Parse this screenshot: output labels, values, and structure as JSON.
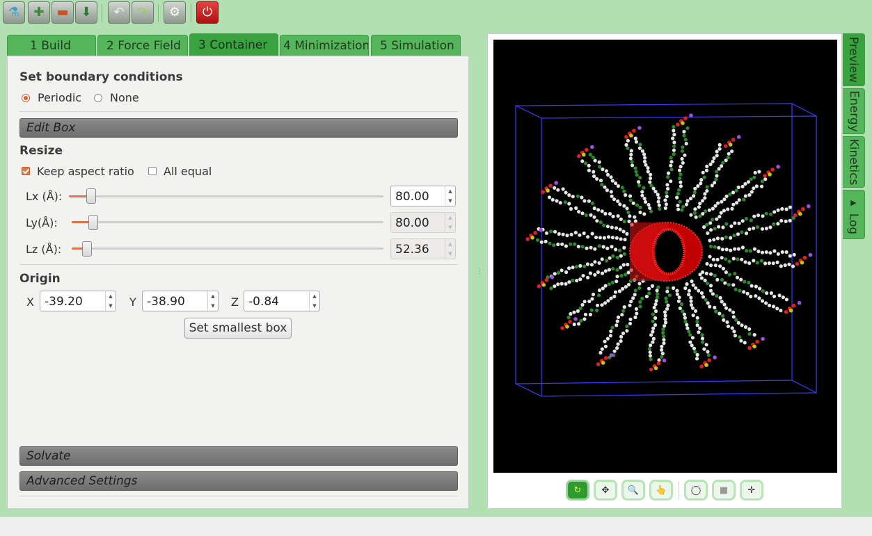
{
  "toolbar": {
    "buttons": [
      {
        "icon": "flask-icon",
        "glyph": "⚗"
      },
      {
        "icon": "new-document-icon",
        "glyph": "✚"
      },
      {
        "icon": "open-folder-icon",
        "glyph": "▬"
      },
      {
        "icon": "save-download-icon",
        "glyph": "⬇"
      },
      {
        "icon": "undo-icon",
        "glyph": "↶"
      },
      {
        "icon": "redo-icon",
        "glyph": "↷"
      },
      {
        "icon": "settings-gear-icon",
        "glyph": "⚙"
      },
      {
        "icon": "power-icon",
        "glyph": "⏻"
      }
    ]
  },
  "tabs": [
    {
      "label": "1  Build"
    },
    {
      "label": "2  Force Field"
    },
    {
      "label": "3  Container"
    },
    {
      "label": "4  Minimization"
    },
    {
      "label": "5  Simulation"
    }
  ],
  "boundary": {
    "title": "Set boundary conditions",
    "periodic": "Periodic",
    "none": "None"
  },
  "edit_box": {
    "header": "Edit Box",
    "resize_title": "Resize",
    "keep_aspect": "Keep aspect ratio",
    "all_equal": "All equal",
    "lx_label": "Lx (Å):",
    "ly_label": "Ly(Å):",
    "lz_label": "Lz (Å):",
    "lx_value": "80.00",
    "ly_value": "80.00",
    "lz_value": "52.36",
    "lx_slider_fraction": 0.07,
    "ly_slider_fraction": 0.07,
    "lz_slider_fraction": 0.05
  },
  "origin": {
    "title": "Origin",
    "x_label": "X",
    "y_label": "Y",
    "z_label": "Z",
    "x_value": "-39.20",
    "y_value": "-38.90",
    "z_value": "-0.84",
    "set_smallest": "Set smallest box"
  },
  "sections": {
    "solvate": "Solvate",
    "advanced": "Advanced Settings"
  },
  "side_tabs": [
    "Preview",
    "Energy",
    "Kinetics",
    "Log"
  ],
  "log_arrow": "▶",
  "viewer_tools": [
    {
      "icon": "rotate-icon",
      "glyph": "↻"
    },
    {
      "icon": "move-icon",
      "glyph": "✥"
    },
    {
      "icon": "zoom-icon",
      "glyph": "🔍"
    },
    {
      "icon": "hand-pointer-icon",
      "glyph": "👆"
    },
    {
      "icon": "sphere-icon",
      "glyph": "◯"
    },
    {
      "icon": "box-view-icon",
      "glyph": "■"
    },
    {
      "icon": "axes-icon",
      "glyph": "✛"
    }
  ],
  "colors": {
    "background": "#b2e0b2",
    "tab_green": "#55b55a",
    "accent_orange": "#e05a2a",
    "nanotube_red": "#e01010",
    "box_blue": "#3a3aff"
  }
}
